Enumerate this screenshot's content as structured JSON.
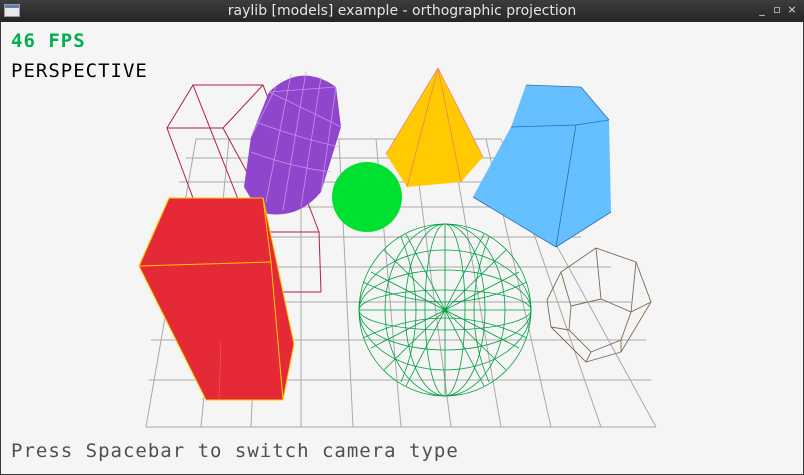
{
  "window": {
    "title": "raylib [models] example - orthographic projection",
    "icon": "app-window-icon",
    "controls": {
      "minimize": "_",
      "maximize": "▫",
      "close": "×"
    }
  },
  "hud": {
    "fps": "46 FPS",
    "camera_mode": "PERSPECTIVE",
    "hint": "Press Spacebar to switch camera type"
  },
  "colors": {
    "fps": "#00b050",
    "background": "#f5f5f5",
    "grid": "#a0a0a0",
    "cube": "#e62937",
    "cube_wires": "#ffcb00",
    "cylinder": "#8f45cc",
    "pyramid": "#ffcb00",
    "sphere_solid": "#00e030",
    "prism": "#66bfff",
    "sphere_wires": "#00a040",
    "hex_wires": "#7f6a4f",
    "box_wires": "#b02040"
  }
}
